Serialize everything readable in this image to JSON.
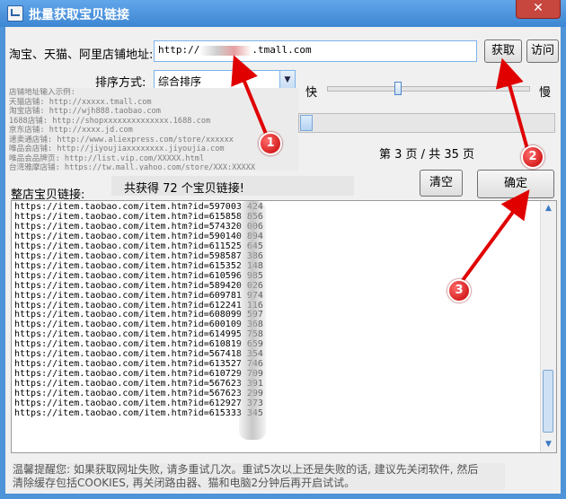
{
  "window": {
    "title": "批量获取宝贝链接",
    "close_label": "✕"
  },
  "store_url": {
    "label": "淘宝、天猫、阿里店铺地址:",
    "value_prefix": "http://",
    "value_suffix": ".tmall.com",
    "fetch_button": "获取",
    "visit_button": "访问"
  },
  "sort": {
    "label": "排序方式:",
    "selected": "综合排序"
  },
  "speed": {
    "fast_label": "快",
    "slow_label": "慢",
    "level": 0.35
  },
  "examples": [
    "店铺地址输入示例:",
    "天猫店铺: http://xxxxx.tmall.com",
    "淘宝店铺: http://wjh888.taobao.com",
    "1688店铺: http://shopxxxxxxxxxxxxxx.1688.com",
    "京东店铺: http://xxxx.jd.com",
    "速卖通店铺: http://www.aliexpress.com/store/xxxxxx",
    "唯品会店铺: http://jiyoujiaxxxxxxxx.jiyoujia.com",
    "唯品会品牌页: http://list.vip.com/XXXXX.html",
    "台湾雅摩店铺: https://tw.mall.yahoo.com/store/XXX:XXXXX"
  ],
  "pagination": {
    "text": "第 3 页 / 共 35 页",
    "progress": 0.02
  },
  "result": {
    "count_text": "共获得 72 个宝贝链接!",
    "clear_button": "清空",
    "confirm_button": "确定",
    "list_label": "整店宝贝链接:",
    "links": [
      "https://item.taobao.com/item.htm?id=597003      424",
      "https://item.taobao.com/item.htm?id=615858      856",
      "https://item.taobao.com/item.htm?id=574320      006",
      "https://item.taobao.com/item.htm?id=590140      894",
      "https://item.taobao.com/item.htm?id=611525      645",
      "https://item.taobao.com/item.htm?id=598587      386",
      "https://item.taobao.com/item.htm?id=615352      148",
      "https://item.taobao.com/item.htm?id=610596      985",
      "https://item.taobao.com/item.htm?id=589420      026",
      "https://item.taobao.com/item.htm?id=609781      974",
      "https://item.taobao.com/item.htm?id=612241      116",
      "https://item.taobao.com/item.htm?id=608099      597",
      "https://item.taobao.com/item.htm?id=600109      368",
      "https://item.taobao.com/item.htm?id=614995      758",
      "https://item.taobao.com/item.htm?id=610819      659",
      "https://item.taobao.com/item.htm?id=567418      354",
      "https://item.taobao.com/item.htm?id=613527      746",
      "https://item.taobao.com/item.htm?id=610729      709",
      "https://item.taobao.com/item.htm?id=567623      391",
      "https://item.taobao.com/item.htm?id=567623      299",
      "https://item.taobao.com/item.htm?id=612927      373",
      "https://item.taobao.com/item.htm?id=615333      345"
    ]
  },
  "footer": {
    "tip_line1": "温馨提醒您: 如果获取网址失败, 请多重试几次。重试5次以上还是失败的话, 建议先关闭软件, 然后",
    "tip_line2": "清除缓存包括COOKIES, 再关闭路由器、猫和电脑2分钟后再开启试试。"
  },
  "markers": [
    "1",
    "2",
    "3"
  ],
  "colors": {
    "title_bar": "#4f93d8",
    "marker": "#d40000",
    "arrow": "#e00000"
  }
}
